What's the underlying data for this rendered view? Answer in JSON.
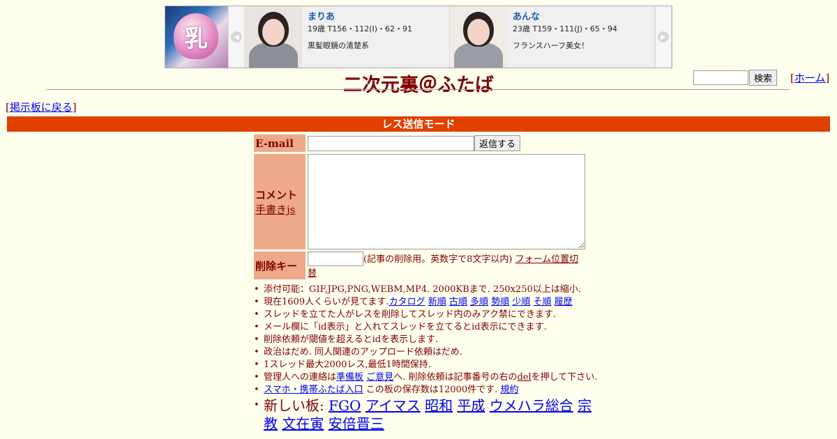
{
  "banner": {
    "logo_char": "乳",
    "prev_icon": "◀",
    "next_icon": "▶",
    "cards": [
      {
        "name": "まりあ",
        "stats": "19歳 T156・112(I)・62・91",
        "desc": "黒髪眼鏡の清楚系"
      },
      {
        "name": "あんな",
        "stats": "23歳 T159・111(J)・65・94",
        "desc": "フランスハーフ美女！"
      }
    ]
  },
  "header": {
    "title": "二次元裏＠ふたば",
    "search_button": "検索",
    "home_link": "ホーム",
    "bracket_open": "[",
    "bracket_close": "]"
  },
  "nav": {
    "back_link": "掲示板に戻る"
  },
  "mode_bar": "レス送信モード",
  "form": {
    "email_label": "E-mail",
    "submit_button": "返信する",
    "comment_label": "コメント",
    "handwrite_link": "手書きjs",
    "delete_label": "削除キー",
    "delete_note": "(記事の削除用。英数字で8文字以内)",
    "form_position_link": "フォーム位置切替"
  },
  "rules": {
    "attach": "添付可能：GIF,JPG,PNG,WEBM,MP4. 2000KBまで. 250x250以上は縮小.",
    "viewers_prefix": "現在1609人くらいが見てます.",
    "sort_links": [
      "カタログ",
      "新順",
      "古順",
      "多順",
      "勢順",
      "少順",
      "そ順",
      "履歴"
    ],
    "thread_lock": "スレッドを立てた人がレスを削除してスレッド内のみアク禁にできます.",
    "id_display": "メール欄に「id表示」と入れてスレッドを立てるとid表示にできます.",
    "id_threshold": "削除依頼が閾値を超えるとidを表示します.",
    "politics": "政治はだめ. 同人関連のアップロード依頼はだめ.",
    "limits": "1スレッド最大2000レス,最低1時間保持.",
    "contact_prefix": "管理人への連絡は",
    "contact_link1": "準備板",
    "contact_link2": "ご意見",
    "contact_suffix1": "へ. 削除依頼は記事番号の右の",
    "del_link": "del",
    "contact_suffix2": "を押して下さい.",
    "mobile_link": "スマホ・携帯ふたば入口",
    "storage": " この板の保存数は12000件です.",
    "terms_link": "規約",
    "new_boards_label": "新しい板:",
    "new_boards": [
      "FGO",
      "アイマス",
      "昭和",
      "平成",
      "ウメハラ総合",
      "宗教",
      "文在寅",
      "安倍晋三"
    ]
  }
}
